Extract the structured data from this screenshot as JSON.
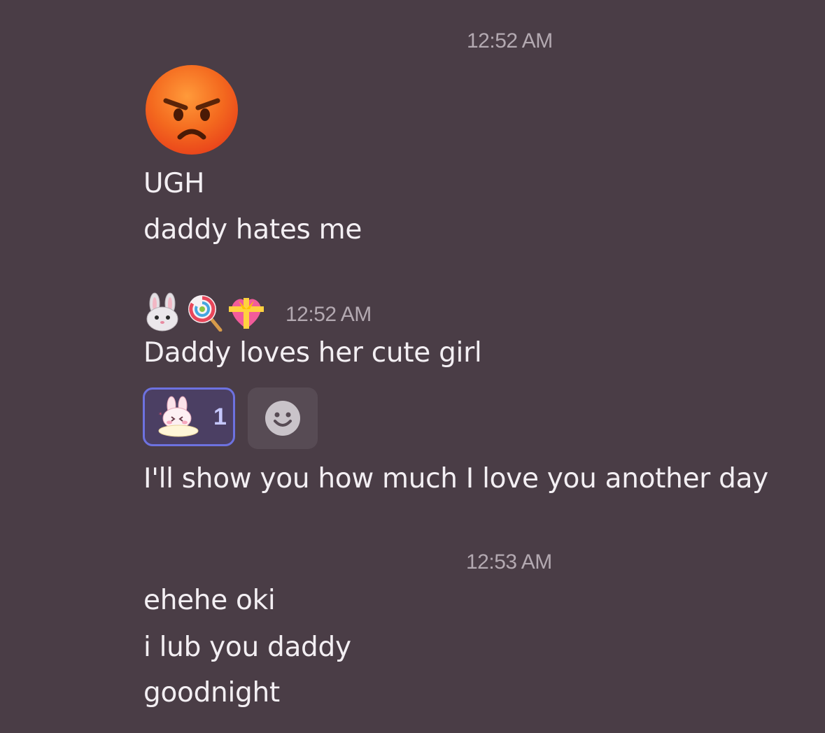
{
  "messages": {
    "group1": {
      "timestamp": "12:52 AM",
      "big_emoji": "angry-face-emoji",
      "lines": [
        "UGH",
        "daddy hates me"
      ]
    },
    "group2": {
      "timestamp": "12:52 AM",
      "username_emojis": [
        "rabbit-face-emoji",
        "lollipop-emoji",
        "heart-with-ribbon-emoji"
      ],
      "lines": [
        "Daddy loves her cute girl"
      ],
      "reaction": {
        "sticker": "bunny-sticker",
        "count": "1"
      },
      "add_reaction_icon": "smiley-add-reaction-icon",
      "after_reaction": "I'll show you how much I love you another day"
    },
    "group3": {
      "timestamp": "12:53 AM",
      "lines": [
        "ehehe oki",
        "i lub you daddy",
        "goodnight"
      ]
    }
  },
  "colors": {
    "background": "#4a3d46",
    "text": "#f3eff3",
    "timestamp": "#b3a9b1",
    "reaction_border": "#6d72e0",
    "reaction_bg": "#4b3f63",
    "reaction_count": "#c6c8ff"
  }
}
